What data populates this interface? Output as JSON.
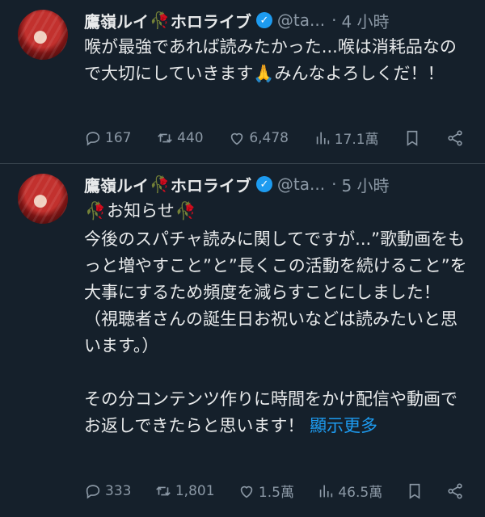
{
  "tweets": [
    {
      "author_name": "鷹嶺ルイ",
      "author_suffix": "ホロライブ",
      "handle": "@ta...",
      "separator": "·",
      "time": "4 小時",
      "text": "喉が最強であれば読みたかった...喉は消耗品なので大切にしていきます🙏みんなよろしくだ！！",
      "replies": "167",
      "retweets": "440",
      "likes": "6,478",
      "views": "17.1萬"
    },
    {
      "author_name": "鷹嶺ルイ",
      "author_suffix": "ホロライブ",
      "handle": "@ta...",
      "separator": "·",
      "time": "5 小時",
      "heading": "お知らせ",
      "text": "今後のスパチャ読みに関してですが...”歌動画をもっと増やすこと”と”長くこの活動を続けること”を大事にするため頻度を減らすことにしました！（視聴者さんの誕生日お祝いなどは読みたいと思います。）\n\nその分コンテンツ作りに時間をかけ配信や動画でお返しできたらと思います！",
      "show_more": "顯示更多",
      "replies": "333",
      "retweets": "1,801",
      "likes": "1.5萬",
      "views": "46.5萬"
    }
  ],
  "icons": {
    "rose": "🥀",
    "verified": "✓"
  },
  "colors": {
    "background": "#15202b",
    "text": "#e7e9ea",
    "muted": "#8b98a5",
    "accent": "#1d9bf0"
  }
}
